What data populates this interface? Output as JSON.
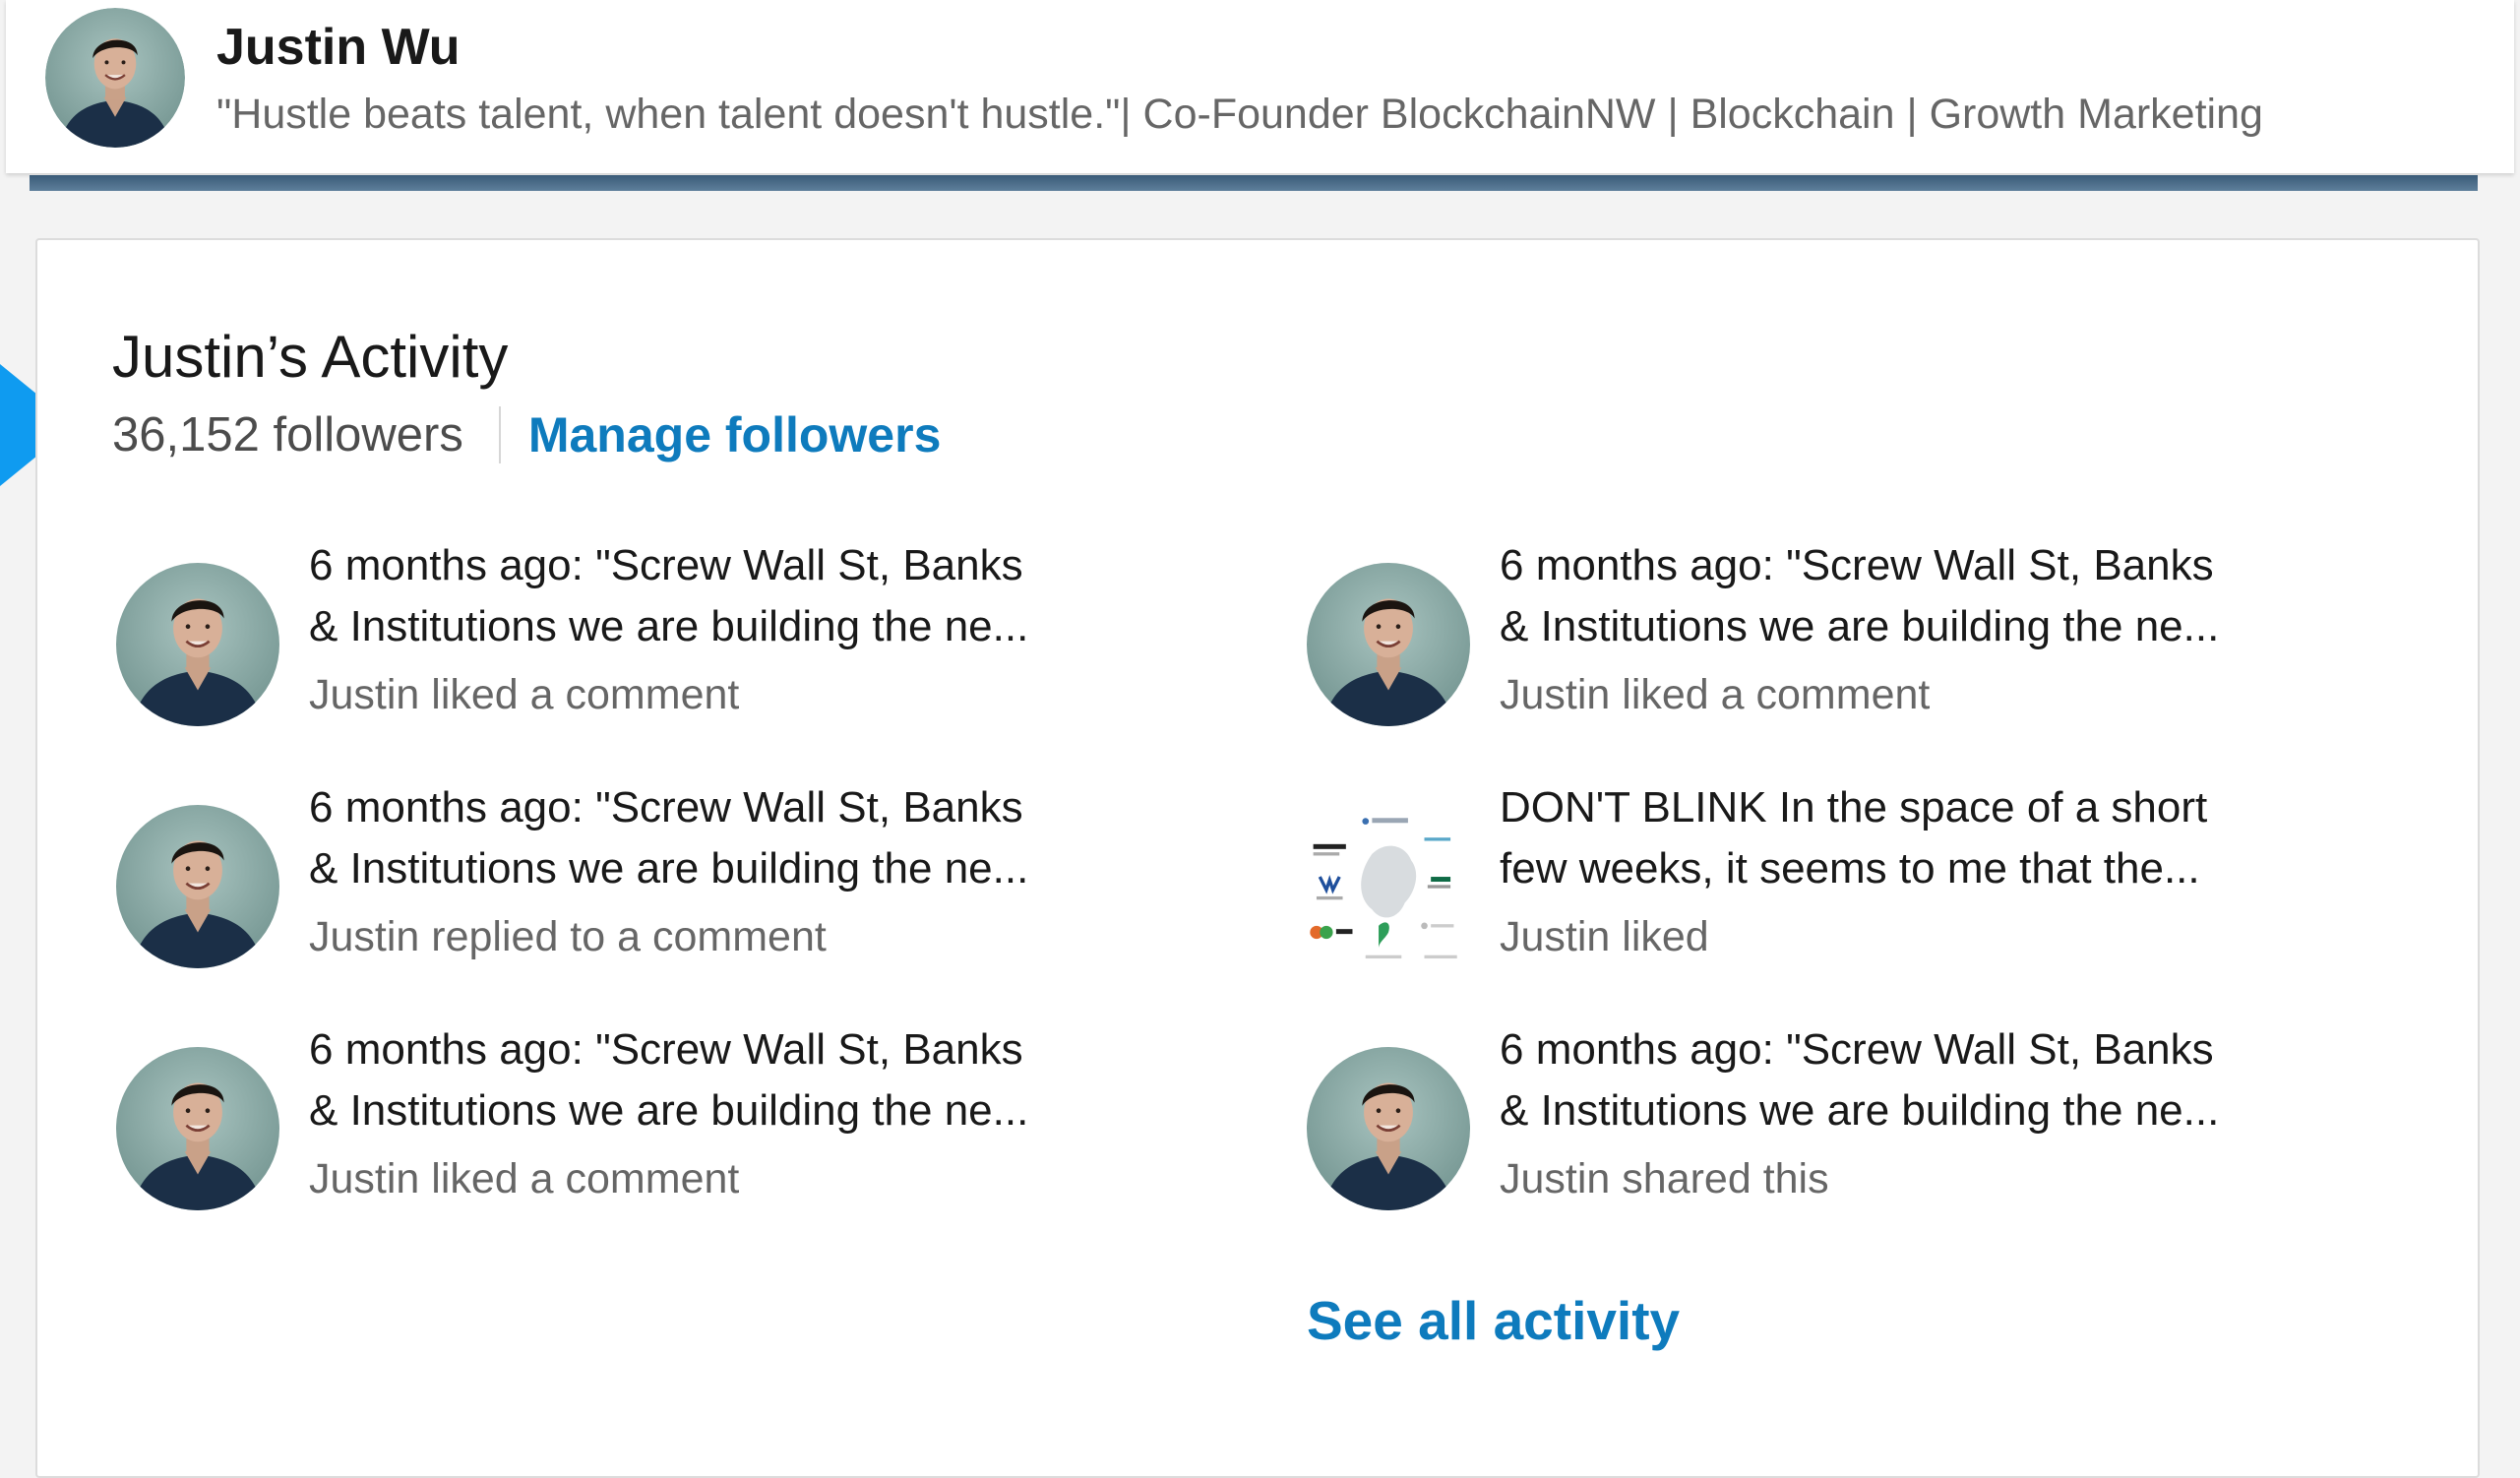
{
  "header": {
    "name": "Justin Wu",
    "headline": "\"Hustle beats talent, when talent doesn't hustle.\"| Co-Founder BlockchainNW | Blockchain | Growth Marketing"
  },
  "activity": {
    "title": "Justin’s Activity",
    "followers": "36,152 followers",
    "manage_label": "Manage followers",
    "see_all_label": "See all activity",
    "items": [
      {
        "line1": "6 months ago: \"Screw Wall St, Banks",
        "line2": "& Institutions we are building the ne...",
        "meta": "Justin liked a comment",
        "thumb": "avatar"
      },
      {
        "line1": "6 months ago: \"Screw Wall St, Banks",
        "line2": "& Institutions we are building the ne...",
        "meta": "Justin liked a comment",
        "thumb": "avatar"
      },
      {
        "line1": "6 months ago: \"Screw Wall St, Banks",
        "line2": "& Institutions we are building the ne...",
        "meta": "Justin replied to a comment",
        "thumb": "avatar"
      },
      {
        "line1": "DON'T BLINK In the space of a short",
        "line2": "few weeks, it seems to me that the...",
        "meta": "Justin liked",
        "thumb": "infographic"
      },
      {
        "line1": "6 months ago: \"Screw Wall St, Banks",
        "line2": "& Institutions we are building the ne...",
        "meta": "Justin liked a comment",
        "thumb": "avatar"
      },
      {
        "line1": "6 months ago: \"Screw Wall St, Banks",
        "line2": "& Institutions we are building the ne...",
        "meta": "Justin shared this",
        "thumb": "avatar"
      }
    ]
  },
  "colors": {
    "link": "#0e7bbd",
    "pointer": "#0f9bf0"
  }
}
